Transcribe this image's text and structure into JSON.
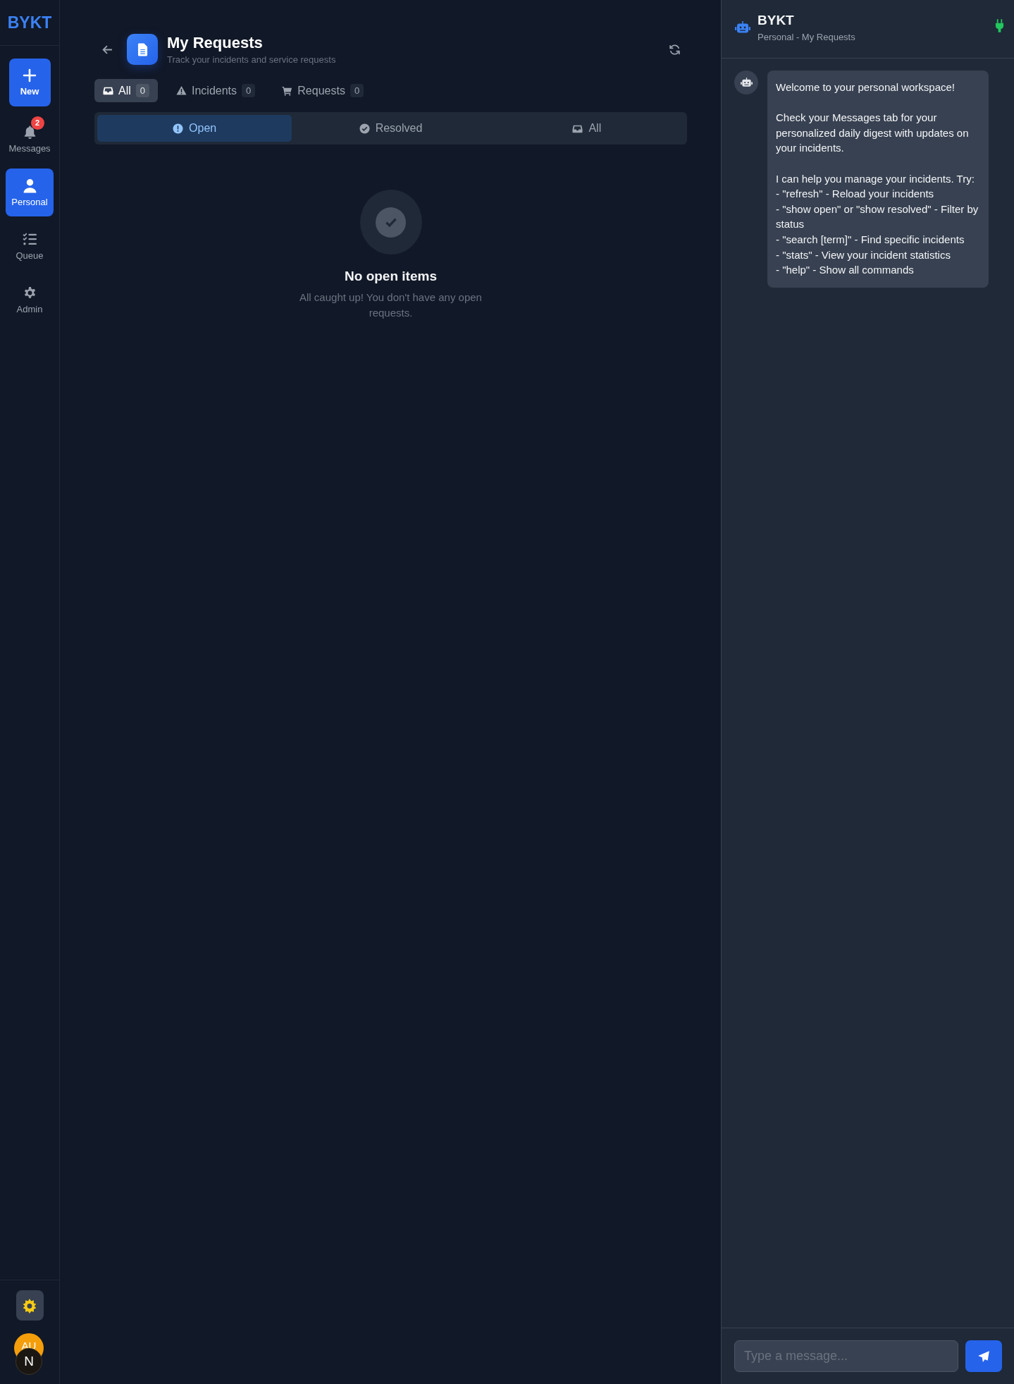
{
  "sidebar": {
    "logo": "BYKT",
    "new_button": "New",
    "items": [
      {
        "kind": "bell",
        "label": "Messages",
        "badge": "2",
        "selected": false
      },
      {
        "kind": "person",
        "label": "Personal",
        "selected": true
      },
      {
        "kind": "list",
        "label": "Queue",
        "selected": false
      },
      {
        "kind": "gear",
        "label": "Admin",
        "selected": false
      }
    ],
    "avatar": {
      "initials": "AU"
    },
    "dev_badge": "N"
  },
  "header": {
    "title": "My Requests",
    "subtitle": "Track your incidents and service requests"
  },
  "type_tabs": [
    {
      "kind": "inbox",
      "label": "All",
      "count": "0",
      "selected": true
    },
    {
      "kind": "warning",
      "label": "Incidents",
      "count": "0",
      "selected": false
    },
    {
      "kind": "cart",
      "label": "Requests",
      "count": "0",
      "selected": false
    }
  ],
  "status_tabs": [
    {
      "kind": "alert",
      "label": "Open",
      "selected": true
    },
    {
      "kind": "check",
      "label": "Resolved",
      "selected": false
    },
    {
      "kind": "inbox",
      "label": "All",
      "selected": false
    }
  ],
  "empty_state": {
    "title": "No open items",
    "message": "All caught up! You don't have any open requests."
  },
  "chat": {
    "title": "BYKT",
    "subtitle": "Personal - My Requests",
    "connected": true,
    "messages": [
      {
        "text": "Welcome to your personal workspace!\n\nCheck your Messages tab for your personalized daily digest with updates on your incidents.\n\nI can help you manage your incidents. Try:\n- \"refresh\" - Reload your incidents\n- \"show open\" or \"show resolved\" - Filter by status\n- \"search [term]\" - Find specific incidents\n- \"stats\" - View your incident statistics\n- \"help\" - Show all commands"
      }
    ],
    "input": {
      "placeholder": "Type a message..."
    }
  }
}
